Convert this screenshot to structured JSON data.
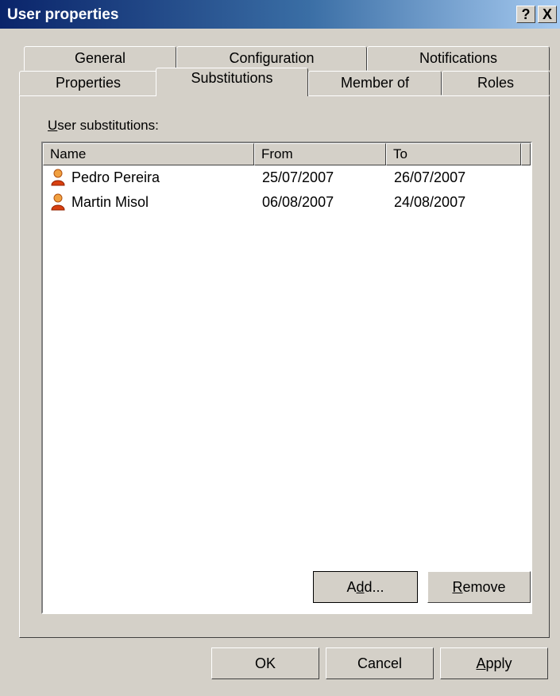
{
  "window": {
    "title": "User properties",
    "help_glyph": "?",
    "close_glyph": "X"
  },
  "tabs": {
    "row1": [
      "General",
      "Configuration",
      "Notifications"
    ],
    "row2": [
      "Properties",
      "Substitutions",
      "Member of",
      "Roles"
    ],
    "active": "Substitutions"
  },
  "substitutions": {
    "label_u": "U",
    "label_rest": "ser substitutions:",
    "columns": [
      "Name",
      "From",
      "To"
    ],
    "rows": [
      {
        "name": "Pedro Pereira",
        "from": "25/07/2007",
        "to": "26/07/2007",
        "icon": "user-icon"
      },
      {
        "name": "Martin Misol",
        "from": "06/08/2007",
        "to": "24/08/2007",
        "icon": "user-icon"
      }
    ],
    "add_pre": "A",
    "add_u": "d",
    "add_post": "d...",
    "remove_u": "R",
    "remove_post": "emove"
  },
  "footer": {
    "ok": "OK",
    "cancel": "Cancel",
    "apply_u": "A",
    "apply_post": "pply"
  },
  "colors": {
    "titlebar_start": "#0a246a",
    "titlebar_end": "#a6caf0",
    "face": "#d4d0c8"
  }
}
